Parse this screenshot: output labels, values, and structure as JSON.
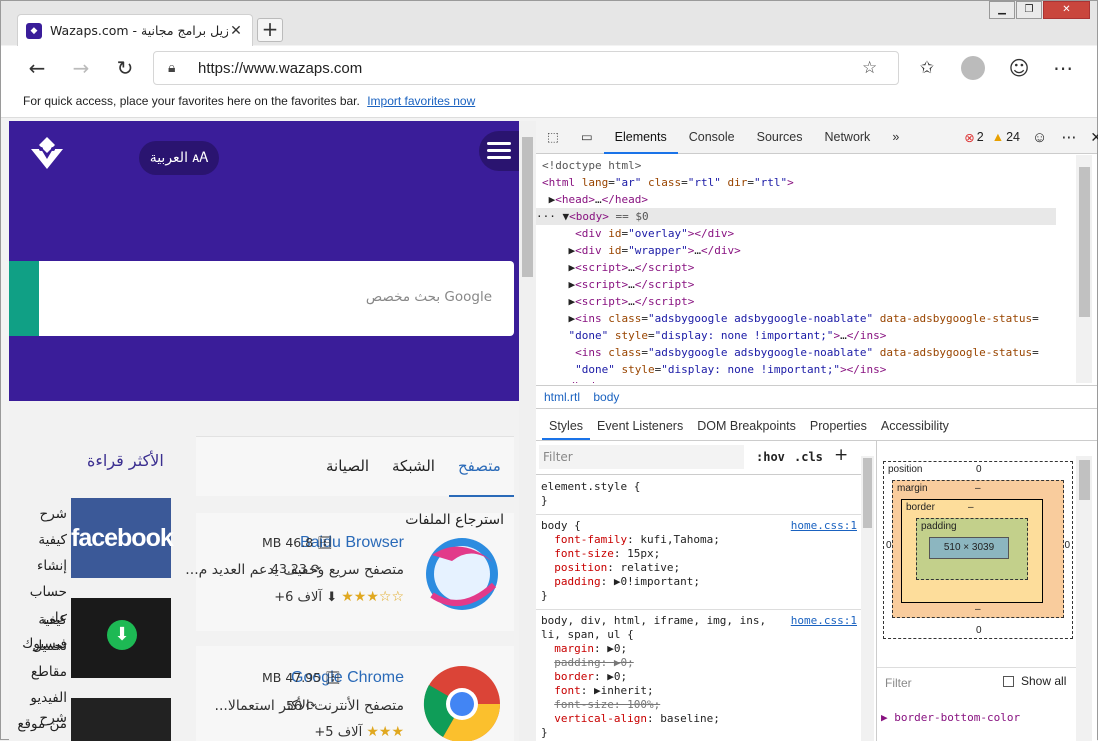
{
  "browser": {
    "tab_title": "Wazaps.com - تنزيل برامج مجانية",
    "url": "https://www.wazaps.com",
    "favorites_hint": "For quick access, place your favorites here on the favorites bar.",
    "favorites_link": "Import favorites now"
  },
  "site": {
    "lang_button": "العربية",
    "search_placeholder": "Google بحث مخصص",
    "tabs": [
      "متصفح",
      "الشبكة",
      "الصيانة"
    ],
    "most_read": "الأكثر قراءة",
    "section_title": "استرجاع الملفات",
    "apps": [
      {
        "name": "Baidu Browser",
        "size": "MB 46.8",
        "version": "43.23",
        "desc": "متصفح سريع وخفيف يدعم العديد م...",
        "downloads": "+6 آلاف"
      },
      {
        "name": "Google Chrome",
        "size": "MB 47.95",
        "version": "56",
        "desc": "متصفح الأنترنت الأكثر استعمالا...",
        "downloads": "+5 آلاف"
      }
    ],
    "side_articles": [
      "شرح كيفية إنشاء حساب على فيسبوك",
      "كيفية تحميل مقاطع الفيديو من موقع",
      "شرح"
    ],
    "facebook_label": "facebook"
  },
  "devtools": {
    "tabs": [
      "Elements",
      "Console",
      "Sources",
      "Network"
    ],
    "errors": "2",
    "warnings": "24",
    "breadcrumbs": [
      "html.rtl",
      "body"
    ],
    "style_tabs": [
      "Styles",
      "Event Listeners",
      "DOM Breakpoints",
      "Properties",
      "Accessibility"
    ],
    "filter_placeholder": "Filter",
    "hov": ":hov",
    "cls": ".cls",
    "box": {
      "position": "position",
      "margin": "margin",
      "border": "border",
      "padding": "padding",
      "content": "510 × 3039",
      "zero": "0",
      "dash": "–"
    },
    "computed_filter": "Filter",
    "show_all": "Show all",
    "computed_first": "border-bottom-color"
  }
}
